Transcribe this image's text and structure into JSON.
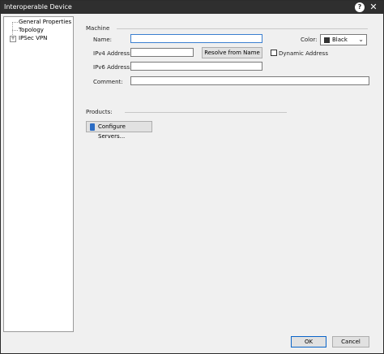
{
  "window": {
    "title": "Interoperable Device",
    "help_label": "?",
    "close_label": "✕"
  },
  "tree": {
    "items": [
      {
        "label": "General Properties"
      },
      {
        "label": "Topology"
      },
      {
        "label": "IPSec VPN"
      }
    ],
    "expander": "+"
  },
  "machine": {
    "section_label": "Machine",
    "name_label": "Name:",
    "name_value": "",
    "color_label": "Color:",
    "color_value": "Black",
    "ipv4_label": "IPv4 Address:",
    "ipv4_value": "",
    "resolve_label": "Resolve from Name",
    "dynamic_label": "Dynamic Address",
    "ipv6_label": "IPv6 Address:",
    "ipv6_value": "",
    "comment_label": "Comment:",
    "comment_value": ""
  },
  "products": {
    "section_label": "Products:",
    "configure_label": "Configure Servers..."
  },
  "footer": {
    "ok_label": "OK",
    "cancel_label": "Cancel"
  },
  "colors": {
    "titlebar": "#2f2f2f",
    "focus": "#3b7fd0",
    "swatch": "#333333",
    "server_icon": "#2b6cc4"
  }
}
